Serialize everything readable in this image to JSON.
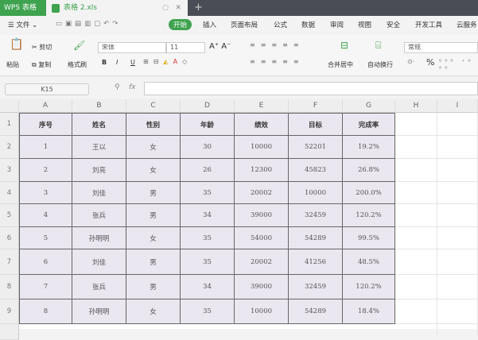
{
  "app": {
    "title": "WPS 表格",
    "doc_tab": "表格 2.xls",
    "new_tab": "+"
  },
  "menu": {
    "file": "文件",
    "items": [
      "开始",
      "插入",
      "页面布局",
      "公式",
      "数据",
      "审阅",
      "视图",
      "安全",
      "开发工具",
      "云服务"
    ]
  },
  "ribbon": {
    "paste": "粘贴",
    "cut": "剪切",
    "copy": "复制",
    "format_painter": "格式刷",
    "font": "宋体",
    "size": "11",
    "bold": "B",
    "italic": "I",
    "underline": "U",
    "merge": "合并居中",
    "wrap": "自动换行",
    "number_format": "常规",
    "percent": "%"
  },
  "formula_bar": {
    "cell_ref": "K15",
    "fx": "fx",
    "value": ""
  },
  "sheet": {
    "columns": [
      "A",
      "B",
      "C",
      "D",
      "E",
      "F",
      "G",
      "H",
      "I"
    ],
    "rows": [
      "1",
      "2",
      "3",
      "4",
      "5",
      "6",
      "7",
      "8",
      "9"
    ],
    "headers": [
      "序号",
      "姓名",
      "性别",
      "年龄",
      "绩效",
      "目标",
      "完成率"
    ],
    "data": [
      [
        "1",
        "王以",
        "女",
        "30",
        "10000",
        "52201",
        "19.2%"
      ],
      [
        "2",
        "刘亮",
        "女",
        "26",
        "12300",
        "45823",
        "26.8%"
      ],
      [
        "3",
        "刘佳",
        "男",
        "35",
        "20002",
        "10000",
        "200.0%"
      ],
      [
        "4",
        "张兵",
        "男",
        "34",
        "39000",
        "32459",
        "120.2%"
      ],
      [
        "5",
        "孙明明",
        "女",
        "35",
        "54000",
        "54289",
        "99.5%"
      ],
      [
        "6",
        "刘佳",
        "男",
        "35",
        "20002",
        "41256",
        "48.5%"
      ],
      [
        "7",
        "张兵",
        "男",
        "34",
        "39000",
        "32459",
        "120.2%"
      ],
      [
        "8",
        "孙明明",
        "女",
        "35",
        "10000",
        "54289",
        "18.4%"
      ]
    ]
  },
  "colors": {
    "accent": "#3fa24f",
    "cell_fill": "#ebe7f1"
  }
}
